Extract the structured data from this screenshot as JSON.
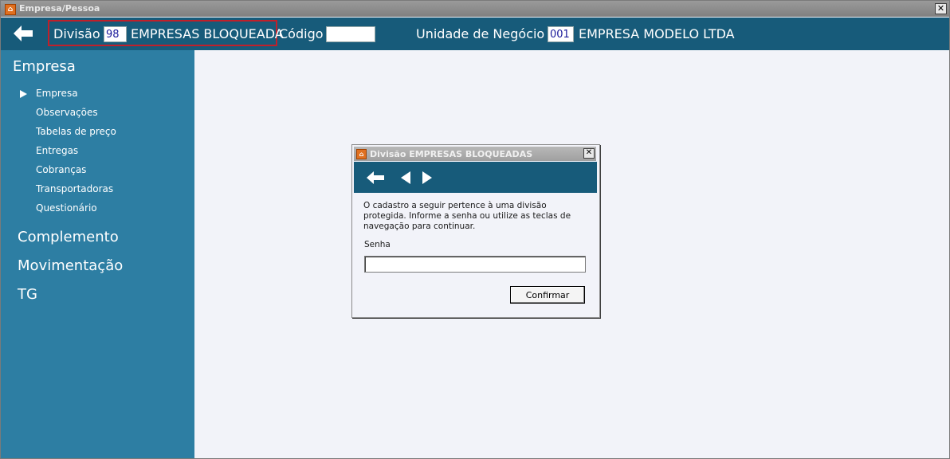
{
  "window": {
    "title": "Empresa/Pessoa",
    "close": "✕"
  },
  "header": {
    "division_label": "Divisão",
    "division_code": "98",
    "division_name": "EMPRESAS BLOQUEADA",
    "code_label": "Código",
    "code_value": "",
    "business_unit_label": "Unidade de Negócio",
    "business_unit_code": "001",
    "business_unit_name": "EMPRESA MODELO LTDA"
  },
  "sidebar": {
    "title": "Empresa",
    "items": [
      "Empresa",
      "Observações",
      "Tabelas de preço",
      "Entregas",
      "Cobranças",
      "Transportadoras",
      "Questionário"
    ],
    "sections": [
      "Complemento",
      "Movimentação",
      "TG"
    ]
  },
  "dialog": {
    "title": "Divisão EMPRESAS BLOQUEADAS",
    "message": "O cadastro a seguir pertence à uma divisão protegida. Informe a senha ou utilize as teclas de navegação para continuar.",
    "password_label": "Senha",
    "password_value": "",
    "confirm_label": "Confirmar"
  },
  "colors": {
    "header": "#175b7a",
    "sidebar": "#2d7ea3",
    "highlight": "#c0202a"
  },
  "icons": [
    "app-icon",
    "back-arrow-icon",
    "previous-icon",
    "next-icon",
    "close-icon"
  ]
}
